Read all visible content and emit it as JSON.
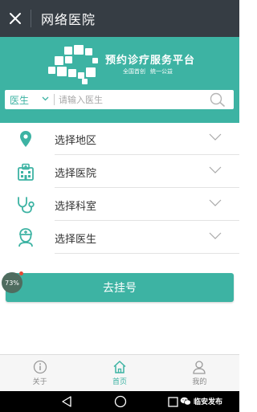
{
  "window": {
    "title": "网络医院",
    "close_icon": "close-icon"
  },
  "banner": {
    "slogan": "预约诊疗服务平台",
    "sub_left": "全国首创",
    "sub_right": "统一公益",
    "background": "#3db3a3"
  },
  "search": {
    "type_label": "医生",
    "placeholder": "请输入医生"
  },
  "selectors": [
    {
      "label": "选择地区",
      "icon": "location-pin-icon"
    },
    {
      "label": "选择医院",
      "icon": "hospital-icon"
    },
    {
      "label": "选择科室",
      "icon": "stethoscope-icon"
    },
    {
      "label": "选择医生",
      "icon": "doctor-icon"
    }
  ],
  "register_button": {
    "label": "去挂号"
  },
  "progress_badge": {
    "text": "73%",
    "value": 73
  },
  "tabs": [
    {
      "label": "关于",
      "icon": "info-icon",
      "active": false
    },
    {
      "label": "首页",
      "icon": "home-icon",
      "active": true
    },
    {
      "label": "我的",
      "icon": "user-icon",
      "active": false
    }
  ],
  "watermark": {
    "text": "临安发布"
  },
  "colors": {
    "accent": "#3db3a3",
    "titlebar": "#363d44",
    "badge_dot": "#e24a36"
  }
}
